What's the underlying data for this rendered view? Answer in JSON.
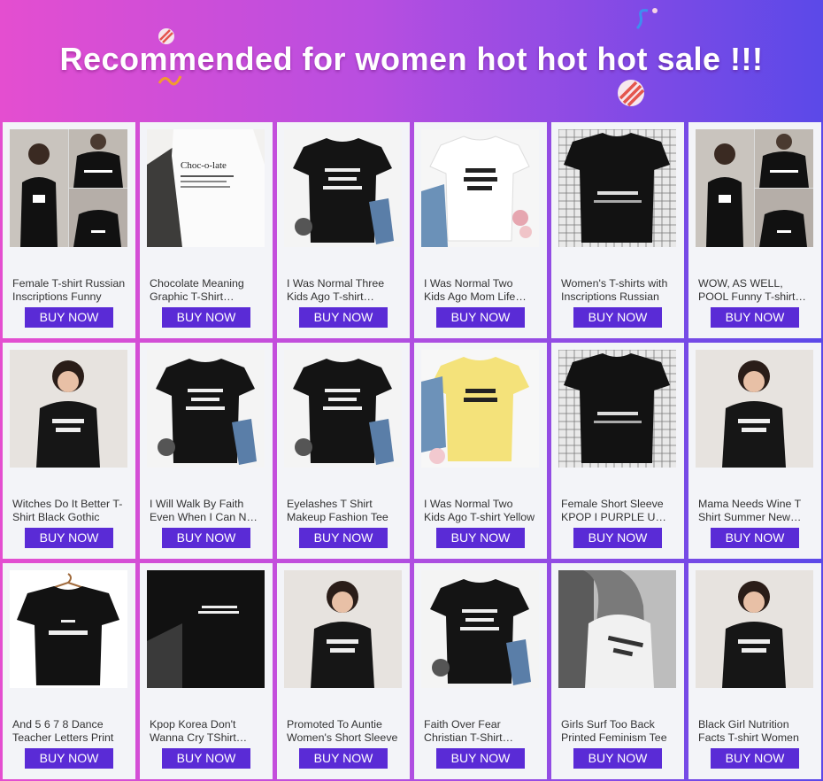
{
  "banner": {
    "title": "Recommended for women hot hot hot sale !!!"
  },
  "colors": {
    "gradient_start": "#e44ed0",
    "gradient_end": "#5b49e8",
    "button": "#5a2bd6",
    "card_bg": "#f3f4f8"
  },
  "products": [
    {
      "title": "Female T-shirt Russian Inscriptions Funny",
      "button": "BUY NOW",
      "image": "tshirt-photo-collage"
    },
    {
      "title": "Chocolate Meaning Graphic T-Shirt Women",
      "button": "BUY NOW",
      "image": "white-tshirt-photo"
    },
    {
      "title": "I Was Normal Three Kids Ago T-shirt Casual",
      "button": "BUY NOW",
      "image": "black-tshirt-flatlay"
    },
    {
      "title": "I Was Normal Two Kids Ago Mom Life Shirt",
      "button": "BUY NOW",
      "image": "white-tshirt-flatlay"
    },
    {
      "title": "Women's T-shirts with Inscriptions Russian",
      "button": "BUY NOW",
      "image": "black-tshirt-grid"
    },
    {
      "title": "WOW, AS WELL, POOL Funny T-shirt Women",
      "button": "BUY NOW",
      "image": "tshirt-photo-collage"
    },
    {
      "title": "Witches Do It Better T-Shirt Black Gothic",
      "button": "BUY NOW",
      "image": "model-photo"
    },
    {
      "title": "I Will Walk By Faith Even When I Can Not See",
      "button": "BUY NOW",
      "image": "black-tshirt-flatlay"
    },
    {
      "title": "Eyelashes T Shirt Makeup Fashion Tee",
      "button": "BUY NOW",
      "image": "black-tshirt-flatlay"
    },
    {
      "title": "I Was Normal Two Kids Ago T-shirt Yellow",
      "button": "BUY NOW",
      "image": "yellow-tshirt-flatlay"
    },
    {
      "title": "Female Short Sleeve KPOP I PURPLE U Tee",
      "button": "BUY NOW",
      "image": "black-tshirt-grid"
    },
    {
      "title": "Mama Needs Wine T Shirt Summer New Women",
      "button": "BUY NOW",
      "image": "model-photo"
    },
    {
      "title": "And 5 6 7 8 Dance Teacher Letters Print",
      "button": "BUY NOW",
      "image": "black-tshirt-hanger"
    },
    {
      "title": "Kpop Korea Don't Wanna Cry TShirt Women",
      "button": "BUY NOW",
      "image": "black-tshirt-photo"
    },
    {
      "title": "Promoted To Auntie Women's Short Sleeve",
      "button": "BUY NOW",
      "image": "model-photo"
    },
    {
      "title": "Faith Over Fear Christian T-Shirt Women",
      "button": "BUY NOW",
      "image": "black-tshirt-flatlay"
    },
    {
      "title": "Girls Surf Too Back Printed Feminism Tee",
      "button": "BUY NOW",
      "image": "bw-model-photo"
    },
    {
      "title": "Black Girl Nutrition Facts T-shirt Women",
      "button": "BUY NOW",
      "image": "model-photo"
    }
  ]
}
